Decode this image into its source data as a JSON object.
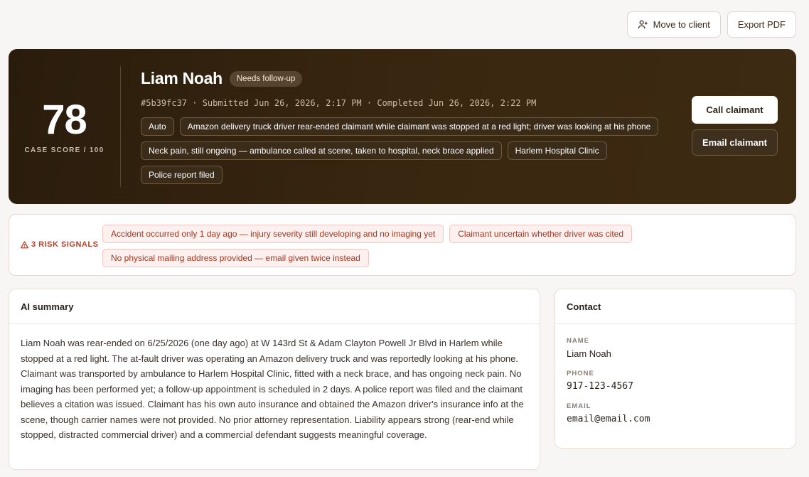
{
  "top_actions": {
    "move_to_client": "Move to client",
    "export_pdf": "Export PDF"
  },
  "hero": {
    "score": "78",
    "score_label": "CASE SCORE / 100",
    "name": "Liam Noah",
    "status": "Needs follow-up",
    "meta": "#5b39fc37 · Submitted Jun 26, 2026, 2:17 PM · Completed Jun 26, 2026, 2:22 PM",
    "tags": [
      "Auto",
      "Amazon delivery truck driver rear-ended claimant while claimant was stopped at a red light; driver was looking at his phone",
      "Neck pain, still ongoing — ambulance called at scene, taken to hospital, neck brace applied",
      "Harlem Hospital Clinic",
      "Police report filed"
    ],
    "call_button": "Call claimant",
    "email_button": "Email claimant"
  },
  "risk": {
    "label": "3 RISK SIGNALS",
    "signals": [
      "Accident occurred only 1 day ago — injury severity still developing and no imaging yet",
      "Claimant uncertain whether driver was cited",
      "No physical mailing address provided — email given twice instead"
    ]
  },
  "summary": {
    "title": "AI summary",
    "text": "Liam Noah was rear-ended on 6/25/2026 (one day ago) at W 143rd St & Adam Clayton Powell Jr Blvd in Harlem while stopped at a red light. The at-fault driver was operating an Amazon delivery truck and was reportedly looking at his phone. Claimant was transported by ambulance to Harlem Hospital Clinic, fitted with a neck brace, and has ongoing neck pain. No imaging has been performed yet; a follow-up appointment is scheduled in 2 days. A police report was filed and the claimant believes a citation was issued. Claimant has his own auto insurance and obtained the Amazon driver's insurance info at the scene, though carrier names were not provided. No prior attorney representation. Liability appears strong (rear-end while stopped, distracted commercial driver) and a commercial defendant suggests meaningful coverage."
  },
  "contact": {
    "title": "Contact",
    "name_label": "NAME",
    "name": "Liam Noah",
    "phone_label": "PHONE",
    "phone": "917-123-4567",
    "email_label": "EMAIL",
    "email": "email@email.com"
  },
  "colors": {
    "hero_bg": "#2f2010",
    "risk_accent": "#b3402a",
    "page_bg": "#f7f6f4"
  }
}
